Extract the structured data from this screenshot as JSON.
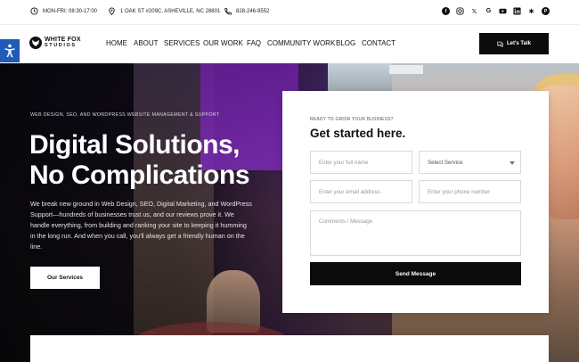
{
  "topbar": {
    "hours": "MON-FRI: 08:30-17:00",
    "address": "1 OAK ST #209C, ASHEVILLE, NC 28801",
    "phone": "828-246-9552",
    "social_icons": [
      "facebook-icon",
      "instagram-icon",
      "x-icon",
      "google-icon",
      "youtube-icon",
      "linkedin-icon",
      "yelp-icon",
      "pinterest-icon"
    ]
  },
  "brand": {
    "line1": "WHITE FOX",
    "line2": "STUDIOS"
  },
  "nav": {
    "items": [
      "HOME",
      "ABOUT",
      "SERVICES",
      "OUR WORK",
      "FAQ",
      "COMMUNITY WORK",
      "BLOG",
      "CONTACT"
    ],
    "cta_label": "Let's Talk"
  },
  "hero": {
    "eyebrow": "WEB DESIGN, SEO, AND WORDPRESS WEBSITE MANAGEMENT & SUPPORT",
    "headline_line1": "Digital Solutions,",
    "headline_line2": "No Complications",
    "intro": "We break new ground in Web Design, SEO, Digital Marketing, and WordPress Support—hundreds of businesses trust us, and our reviews prove it. We handle everything, from building and ranking your site to keeping it humming in the long run. And when you call, you'll always get a friendly human on the line.",
    "button_label": "Our Services"
  },
  "form": {
    "kicker": "READY TO GROW YOUR BUSINESS?",
    "title": "Get started here.",
    "name_placeholder": "Enter your full name",
    "service_selected": "Select Service",
    "email_placeholder": "Enter your email address",
    "phone_placeholder": "Enter your phone number",
    "message_placeholder": "Comments / Message",
    "submit_label": "Send Message"
  },
  "colors": {
    "accent_dark": "#0b0b0b",
    "accessibility_blue": "#1f5cb8",
    "hero_purple": "#6b1f9d"
  }
}
